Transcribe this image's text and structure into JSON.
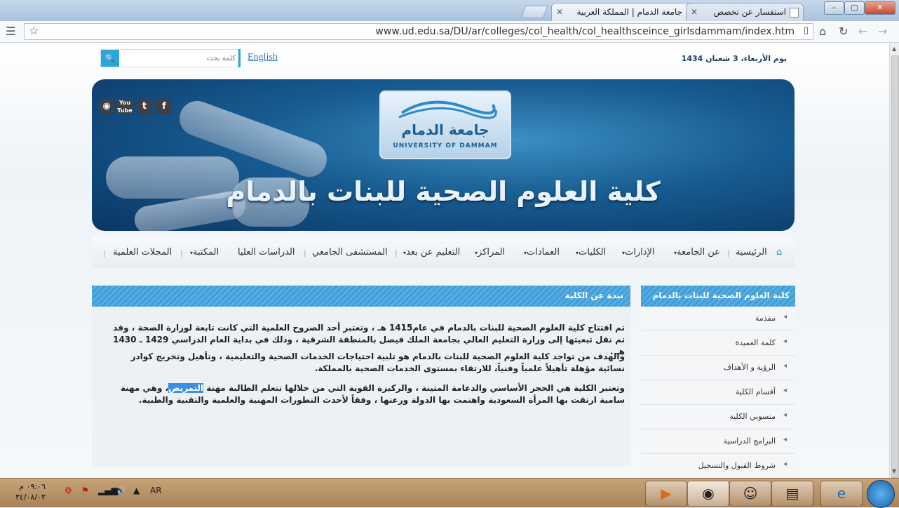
{
  "browser": {
    "tabs": [
      {
        "label": "جامعة الدمام | المملكة العربية"
      },
      {
        "label": "استفسار عن تخصص"
      }
    ],
    "url": "www.ud.edu.sa/DU/ar/colleges/col_health/col_healthsceince_girlsdammam/index.htm",
    "window_controls": {
      "minimize": "–",
      "maximize": "▢",
      "close": "✕"
    }
  },
  "header": {
    "date": "يوم الأربعاء، 3 شعبان 1434",
    "search_placeholder": "كلمة بحث",
    "english_link": "English"
  },
  "banner": {
    "logo_ar": "جامعة الدمام",
    "logo_en": "UNIVERSITY OF DAMMAM",
    "college_title": "كلية العلوم الصحية للبنات بالدمام",
    "social": [
      "RSS",
      "YouTube",
      "Twitter",
      "Facebook"
    ]
  },
  "nav": {
    "items": [
      "الرئيسية",
      "عن الجامعة",
      "الإدارات",
      "الكليات",
      "العمادات",
      "المراكز",
      "التعليم عن بعد",
      "المستشفى الجامعي",
      "الدراسات العليا",
      "المكتبة",
      "المجلات العلمية"
    ]
  },
  "main": {
    "heading": "نبذة عن الكلية",
    "p1": "تم افتتاح كلية العلوم الصحية للبنات بالدمام في عام1415 هـ ، وتعتبر أحد الصروح العلمية التي كانت تابعة لوزارة الصحة ، وقد تم نقل تبعيتها إلى وزارة التعليم العالي بجامعة الملك فيصل بالمنطقة الشرقية ، وذلك في بداية العام الدراسي 1429 ـ 1430 هـ .",
    "p2": "والهدف من تواجد كلية العلوم الصحية للبنات بالدمام هو تلبية احتياجات الخدمات الصحية والتعليمية ، وتأهيل وتخريج كوادر نسائية مؤهلة تأهيلاً علمياً وفنياً، للارتقاء بمستوى الخدمات الصحية بالمملكة.",
    "p3_before": "وتعتبر الكلية هي الحجر الأساسي والدعامة المتينة ، والركيزة القوية التي من خلالها تتعلم الطالبة مهنة ",
    "p3_highlight": "التمريض",
    "p3_after": "، وهي مهنة سامية ارتقت بها المرأة السعودية واهتمت بها الدولة ورعتها ، وفقاً لأحدث التطورات المهنية والعلمية والتقنية والطبية."
  },
  "sidebar": {
    "heading": "كلية العلوم الصحية للبنات بالدمام",
    "items": [
      "مقدمة",
      "كلمة العميدة",
      "الرؤية و الأهداف",
      "أقسام الكلية",
      "منسوبي الكلية",
      "البرامج الدراسية",
      "شروط القبول والتسجيل"
    ]
  },
  "taskbar": {
    "lang": "AR",
    "time": "٠٩:٠٦ م",
    "date": "٣٤/٠٨/٠٣"
  }
}
